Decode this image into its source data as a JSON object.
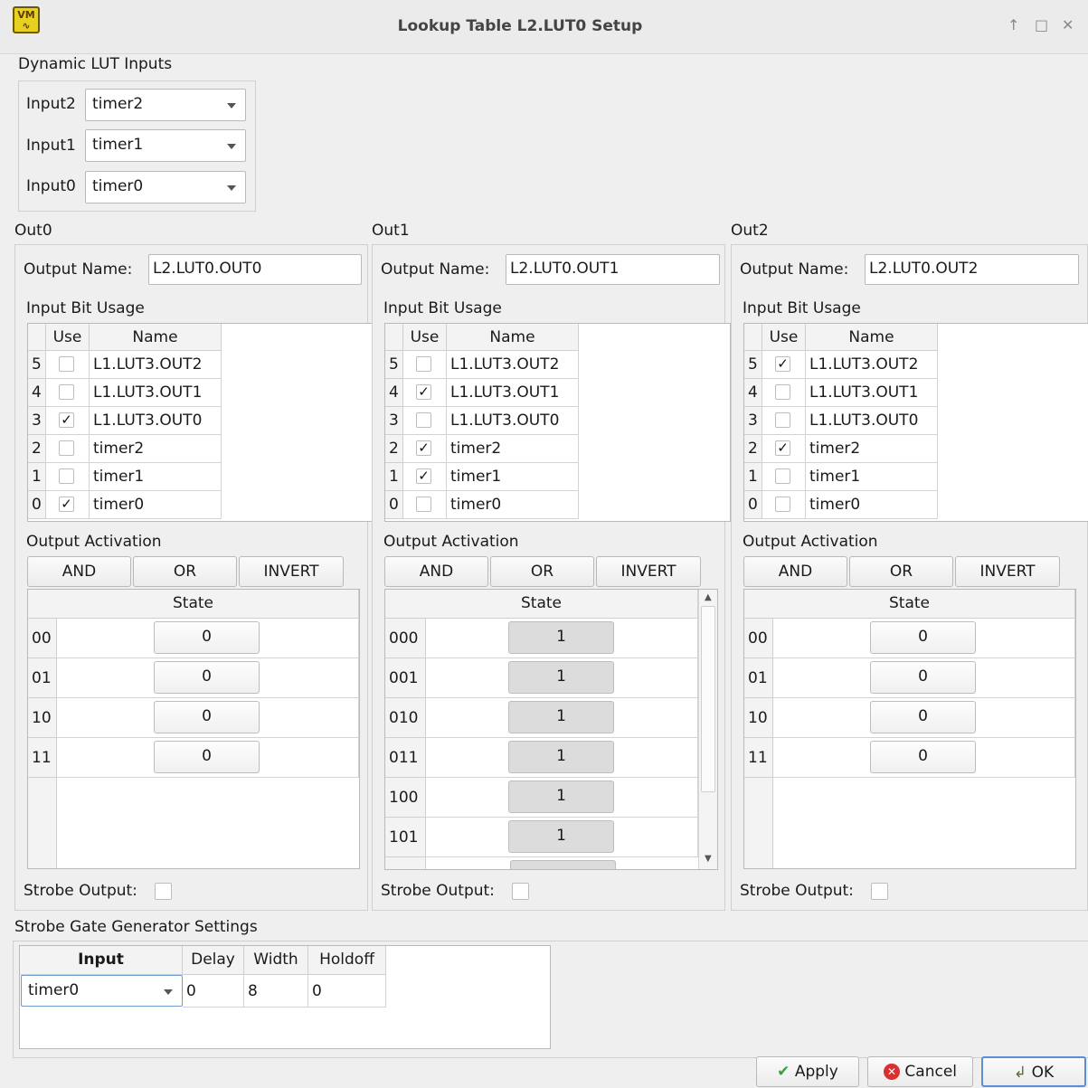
{
  "window": {
    "title": "Lookup Table L2.LUT0 Setup",
    "icon": "app-logo-icon",
    "controls": [
      "↑",
      "□",
      "✕"
    ]
  },
  "dynamic_inputs": {
    "title": "Dynamic LUT Inputs",
    "rows": [
      {
        "label": "Input2",
        "value": "timer2"
      },
      {
        "label": "Input1",
        "value": "timer1"
      },
      {
        "label": "Input0",
        "value": "timer0"
      }
    ]
  },
  "outputs": [
    {
      "title": "Out0",
      "name_label": "Output Name:",
      "name_value": "L2.LUT0.OUT0",
      "bit_usage_title": "Input Bit Usage",
      "col_use": "Use",
      "col_name": "Name",
      "bits": [
        {
          "idx": "5",
          "use": "",
          "name": "L1.LUT3.OUT2"
        },
        {
          "idx": "4",
          "use": "",
          "name": "L1.LUT3.OUT1"
        },
        {
          "idx": "3",
          "use": "✓",
          "name": "L1.LUT3.OUT0"
        },
        {
          "idx": "2",
          "use": "",
          "name": "timer2"
        },
        {
          "idx": "1",
          "use": "",
          "name": "timer1"
        },
        {
          "idx": "0",
          "use": "✓",
          "name": "timer0"
        }
      ],
      "activation_title": "Output Activation",
      "btn_and": "AND",
      "btn_or": "OR",
      "btn_invert": "INVERT",
      "state_header": "State",
      "states": [
        {
          "row": "00",
          "value": "0"
        },
        {
          "row": "01",
          "value": "0"
        },
        {
          "row": "10",
          "value": "0"
        },
        {
          "row": "11",
          "value": "0"
        }
      ],
      "strobe_label": "Strobe Output:"
    },
    {
      "title": "Out1",
      "name_label": "Output Name:",
      "name_value": "L2.LUT0.OUT1",
      "bit_usage_title": "Input Bit Usage",
      "col_use": "Use",
      "col_name": "Name",
      "bits": [
        {
          "idx": "5",
          "use": "",
          "name": "L1.LUT3.OUT2"
        },
        {
          "idx": "4",
          "use": "✓",
          "name": "L1.LUT3.OUT1"
        },
        {
          "idx": "3",
          "use": "",
          "name": "L1.LUT3.OUT0"
        },
        {
          "idx": "2",
          "use": "✓",
          "name": "timer2"
        },
        {
          "idx": "1",
          "use": "✓",
          "name": "timer1"
        },
        {
          "idx": "0",
          "use": "",
          "name": "timer0"
        }
      ],
      "activation_title": "Output Activation",
      "btn_and": "AND",
      "btn_or": "OR",
      "btn_invert": "INVERT",
      "state_header": "State",
      "states": [
        {
          "row": "000",
          "value": "1"
        },
        {
          "row": "001",
          "value": "1"
        },
        {
          "row": "010",
          "value": "1"
        },
        {
          "row": "011",
          "value": "1"
        },
        {
          "row": "100",
          "value": "1"
        },
        {
          "row": "101",
          "value": "1"
        }
      ],
      "strobe_label": "Strobe Output:"
    },
    {
      "title": "Out2",
      "name_label": "Output Name:",
      "name_value": "L2.LUT0.OUT2",
      "bit_usage_title": "Input Bit Usage",
      "col_use": "Use",
      "col_name": "Name",
      "bits": [
        {
          "idx": "5",
          "use": "✓",
          "name": "L1.LUT3.OUT2"
        },
        {
          "idx": "4",
          "use": "",
          "name": "L1.LUT3.OUT1"
        },
        {
          "idx": "3",
          "use": "",
          "name": "L1.LUT3.OUT0"
        },
        {
          "idx": "2",
          "use": "✓",
          "name": "timer2"
        },
        {
          "idx": "1",
          "use": "",
          "name": "timer1"
        },
        {
          "idx": "0",
          "use": "",
          "name": "timer0"
        }
      ],
      "activation_title": "Output Activation",
      "btn_and": "AND",
      "btn_or": "OR",
      "btn_invert": "INVERT",
      "state_header": "State",
      "states": [
        {
          "row": "00",
          "value": "0"
        },
        {
          "row": "01",
          "value": "0"
        },
        {
          "row": "10",
          "value": "0"
        },
        {
          "row": "11",
          "value": "0"
        }
      ],
      "strobe_label": "Strobe Output:"
    }
  ],
  "strobe_gate": {
    "title": "Strobe Gate Generator Settings",
    "headers": {
      "input": "Input",
      "delay": "Delay",
      "width": "Width",
      "holdoff": "Holdoff"
    },
    "row": {
      "input": "timer0",
      "delay": "0",
      "width": "8",
      "holdoff": "0"
    }
  },
  "buttons": {
    "apply": "Apply",
    "cancel": "Cancel",
    "ok": "OK"
  }
}
